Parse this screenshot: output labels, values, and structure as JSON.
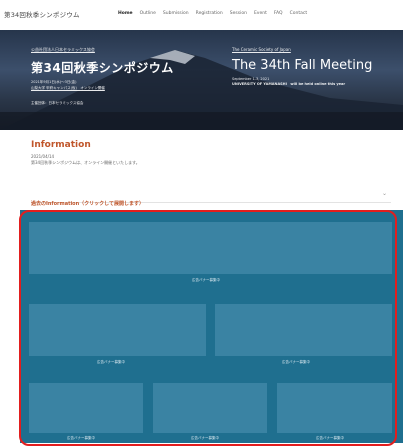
{
  "header": {
    "site_title": "第34回秋季シンポジウム",
    "nav": [
      "Home",
      "Outline",
      "Submission",
      "Registration",
      "Session",
      "Event",
      "FAQ",
      "Contact"
    ]
  },
  "hero": {
    "left_org": "公益社団法人日本セラミックス協会",
    "left_title": "第34回秋季シンポジウム",
    "left_date": "2021年9月1日(水)〜3日(金)",
    "left_place": "山梨大学 甲府キャンパス(仮)　オンライン開催",
    "left_host": "主催団体：日本セラミックス協会",
    "right_org": "The Ceramic Society of Japan",
    "right_title": "The 34th Fall Meeting",
    "right_date": "September 1-3, 2021",
    "right_place": "UNIVERSITY OF YAMANASHI　will be held online this year"
  },
  "information": {
    "title": "Information",
    "date": "2021/04/14",
    "body": "第34回秋季シンポジウムは、オンライン開催といたします。"
  },
  "past_info": {
    "label": "過去のInformation（クリックして展開します）"
  },
  "banners": {
    "label": "広告バナー募集中"
  },
  "colors": {
    "accent": "#c0562b",
    "banner_bg": "#1f6f8f",
    "highlight": "#e11e1e"
  }
}
